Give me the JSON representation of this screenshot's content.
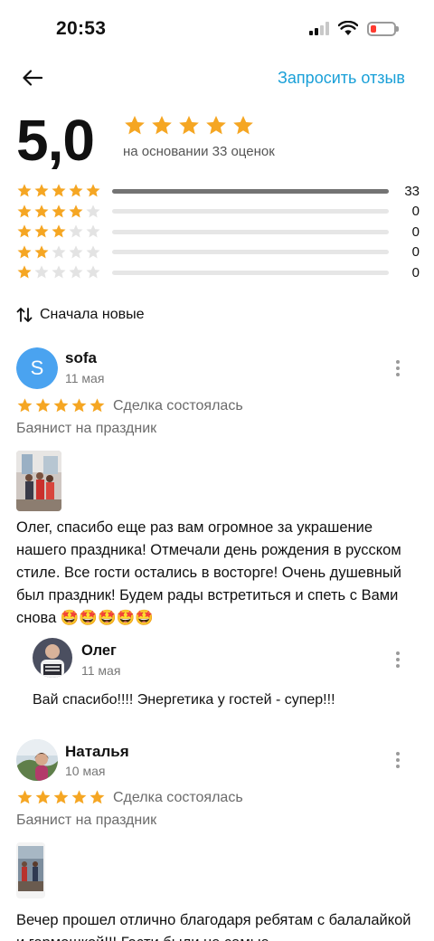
{
  "status": {
    "time": "20:53"
  },
  "topbar": {
    "request_review": "Запросить отзыв"
  },
  "rating": {
    "score": "5,0",
    "stars": 5,
    "based_on": "на основании 33 оценок",
    "distribution": [
      {
        "stars": 5,
        "count": "33",
        "fraction": 1.0
      },
      {
        "stars": 4,
        "count": "0",
        "fraction": 0
      },
      {
        "stars": 3,
        "count": "0",
        "fraction": 0
      },
      {
        "stars": 2,
        "count": "0",
        "fraction": 0
      },
      {
        "stars": 1,
        "count": "0",
        "fraction": 0
      }
    ]
  },
  "sort": {
    "label": "Сначала новые"
  },
  "reviews": [
    {
      "avatar_letter": "S",
      "author": "sofa",
      "date": "11 мая",
      "stars": 5,
      "deal": "Сделка состоялась",
      "service": "Баянист на праздник",
      "text": "Олег, спасибо еще раз вам огромное за украшение нашего праздника! Отмечали день рождения в русском стиле. Все гости остались в восторге! Очень душевный был праздник! Будем рады встретиться и спеть с Вами снова 🤩🤩🤩🤩🤩",
      "reply": {
        "author": "Олег",
        "date": "11 мая",
        "text": "Вай спасибо!!!! Энергетика у гостей - супер!!!"
      }
    },
    {
      "author": "Наталья",
      "date": "10 мая",
      "stars": 5,
      "deal": "Сделка состоялась",
      "service": "Баянист на праздник",
      "text": "Вечер прошел отлично благодаря ребятам с балалайкой и гармошкой!!! Гости были не самые"
    }
  ],
  "colors": {
    "accent": "#1aa0d8",
    "star": "#f5a623",
    "star_empty": "#e3e3e3",
    "avatar_bg": "#4aa3f0"
  },
  "icons": [
    "back-arrow-icon",
    "star-icon",
    "sort-arrows-icon",
    "more-vertical-icon",
    "wifi-icon",
    "signal-icon",
    "battery-icon"
  ]
}
